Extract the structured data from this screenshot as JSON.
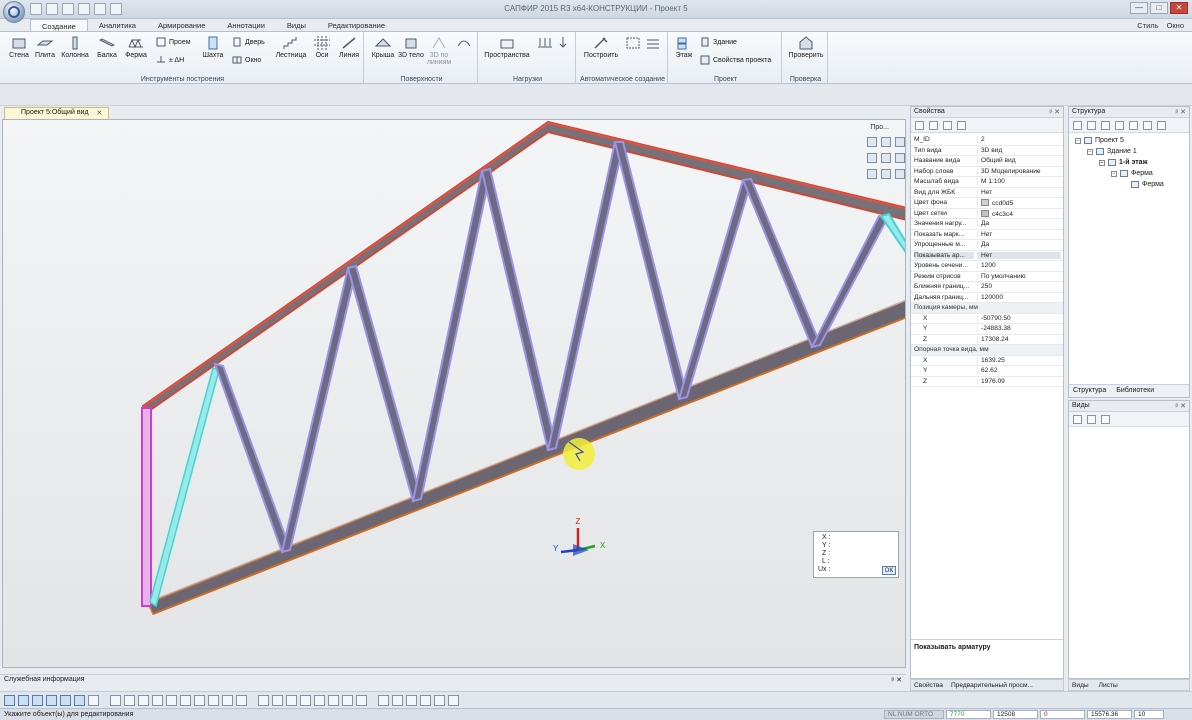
{
  "window": {
    "title": "САПФИР 2015 R3 x64-КОНСТРУКЦИИ - Проект 5",
    "minimize": "—",
    "maximize": "□",
    "close": "✕"
  },
  "ribbon_tabs": [
    "Создание",
    "Аналитика",
    "Армирование",
    "Аннотации",
    "Виды",
    "Редактирование"
  ],
  "ribbon_right": {
    "style": "Стиль",
    "window": "Окно"
  },
  "ribbon": {
    "group_build": {
      "label": "Инструменты построения",
      "wall": "Стена",
      "slab": "Плита",
      "column": "Колонна",
      "beam": "Балка",
      "truss": "Ферма",
      "opening": "Проем",
      "dh": "± ΔH",
      "shaft": "Шахта",
      "door": "Дверь",
      "window": "Окно",
      "stairs": "Лестница",
      "axes": "Оси",
      "line": "Линия"
    },
    "group_surfaces": {
      "label": "Поверхности",
      "roof": "Крыша",
      "body3d": "3D тело",
      "by_lines": "3D по линиям"
    },
    "group_loads": {
      "label": "Нагрузки",
      "spaces": "Пространства"
    },
    "group_auto": {
      "label": "Автоматическое создание",
      "build": "Построить"
    },
    "group_project": {
      "label": "Проект",
      "floor": "Этаж",
      "building": "Здание",
      "props": "Свойства проекта"
    },
    "group_check": {
      "label": "Проверка",
      "check": "Проверить"
    }
  },
  "doc_tab": {
    "label": "Проект 5:Общий вид",
    "close": "✕"
  },
  "viewport": {
    "view_menu": "Про...",
    "axis_x": "X",
    "axis_y": "Y",
    "axis_z": "Z",
    "coords": {
      "x": "X :",
      "y": "Y :",
      "z": "Z :",
      "l": "L :",
      "ux": "Ux :",
      "ok": "OK"
    }
  },
  "properties": {
    "title": "Свойства",
    "pins": "ᵖ ✕",
    "rows": [
      {
        "k": "M_ID",
        "v": "2"
      },
      {
        "k": "Тип вида",
        "v": "3D вид"
      },
      {
        "k": "Название вида",
        "v": "Общий вид"
      },
      {
        "k": "Набор слоев",
        "v": "3D Моделирование"
      },
      {
        "k": "Масштаб вида",
        "v": "М 1:100"
      },
      {
        "k": "Вид для ЖБК",
        "v": "Нет"
      },
      {
        "k": "Цвет фона",
        "v": "ccd0d5",
        "swatch": "#ccd0d5"
      },
      {
        "k": "Цвет сетки",
        "v": "c4c3c4",
        "swatch": "#c4c3c4"
      },
      {
        "k": "Значения нагру...",
        "v": "Да"
      },
      {
        "k": "Показать марк...",
        "v": "Нет"
      },
      {
        "k": "Упрощенные м...",
        "v": "Да"
      },
      {
        "k": "Показывать ар...",
        "v": "Нет",
        "sel": true
      },
      {
        "k": "Уровень сечени...",
        "v": "1200"
      },
      {
        "k": "Режим отрисов",
        "v": "По умолчанию"
      },
      {
        "k": "Ближняя границ...",
        "v": "250"
      },
      {
        "k": "Дальняя границ...",
        "v": "120000"
      }
    ],
    "camera_cat": "Позиция камеры, мм",
    "camera": [
      {
        "k": "X",
        "v": "-50790.50"
      },
      {
        "k": "Y",
        "v": "-24883.38"
      },
      {
        "k": "Z",
        "v": "17308.24"
      }
    ],
    "anchor_cat": "Опорная точка вида, мм",
    "anchor": [
      {
        "k": "X",
        "v": "1639.25"
      },
      {
        "k": "Y",
        "v": "62.62"
      },
      {
        "k": "Z",
        "v": "1976.09"
      }
    ],
    "description": "Показывать арматуру"
  },
  "structure": {
    "title": "Структура",
    "pins": "ᵖ ✕",
    "tree": [
      "Проект 5",
      "Здание 1",
      "1-й этаж",
      "Ферма",
      "Ферма"
    ],
    "tab_structure": "Структура",
    "tab_libraries": "Библиотеки"
  },
  "views": {
    "title": "Виды",
    "pins": "ᵖ ✕"
  },
  "bottom_tabs": {
    "props": "Свойства",
    "preview": "Предварительный просм...",
    "views": "Виды",
    "sheets": "Листы"
  },
  "service": {
    "label": "Служебная информация",
    "pins": "ᵖ ✕"
  },
  "status": {
    "message": "Укажите объект(ы) для редактирования",
    "flags": "NL NUM ORTO",
    "v1": "7770",
    "v2": "12508",
    "v3": "0",
    "v4": "15576.36",
    "v5": "10"
  },
  "colors": {
    "top_chord": "#c94a3a",
    "bottom_chord": "#d97a2a",
    "web": "#6e6a84",
    "web_highlight": "#9c93e6",
    "post": "#d53ad0",
    "diagonal_cyan": "#3fd6d6"
  }
}
